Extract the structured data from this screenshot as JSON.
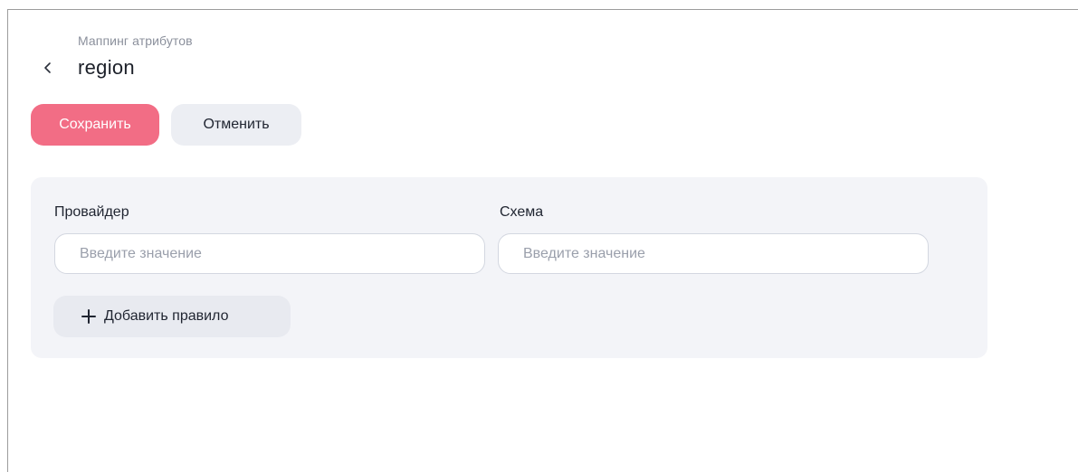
{
  "header": {
    "breadcrumb": "Маппинг атрибутов",
    "title": "region",
    "back_icon": "chevron-left-icon"
  },
  "actions": {
    "save_label": "Сохранить",
    "cancel_label": "Отменить"
  },
  "form": {
    "provider": {
      "label": "Провайдер",
      "value": "",
      "placeholder": "Введите значение"
    },
    "schema": {
      "label": "Схема",
      "value": "",
      "placeholder": "Введите значение"
    },
    "add_rule_label": "Добавить правило",
    "add_rule_icon": "plus-icon"
  },
  "colors": {
    "primary": "#f26d85",
    "secondary_button": "#eceef3",
    "panel_background": "#f3f4f8",
    "input_border": "#d3d7e0"
  }
}
